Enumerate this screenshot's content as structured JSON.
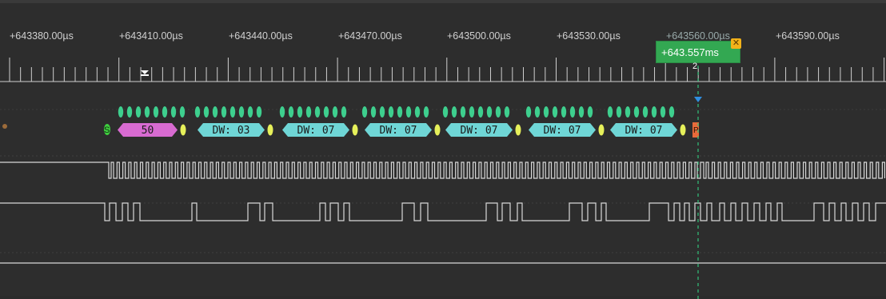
{
  "ruler": {
    "labels": [
      "+643380.00µs",
      "+643410.00µs",
      "+643440.00µs",
      "+643470.00µs",
      "+643500.00µs",
      "+643530.00µs",
      "+643560.00µs",
      "+643590.00µs"
    ]
  },
  "marker": {
    "time": "+643.557ms",
    "index": "2",
    "close_icon": "close-icon"
  },
  "decode": {
    "start_symbol": "S",
    "stop_symbol": "P",
    "packets": [
      "50",
      "DW: 03",
      "DW: 07",
      "DW: 07",
      "DW: 07",
      "DW: 07",
      "DW: 07"
    ]
  },
  "colors": {
    "background": "#2d2d2d",
    "bits": "#3ecf8e",
    "packet_first": "#d86bd1",
    "packet": "#6fd6d6",
    "ack": "#e6f05a",
    "start": "#3fcf3f",
    "stop": "#e86a3a",
    "marker": "#33a852"
  }
}
